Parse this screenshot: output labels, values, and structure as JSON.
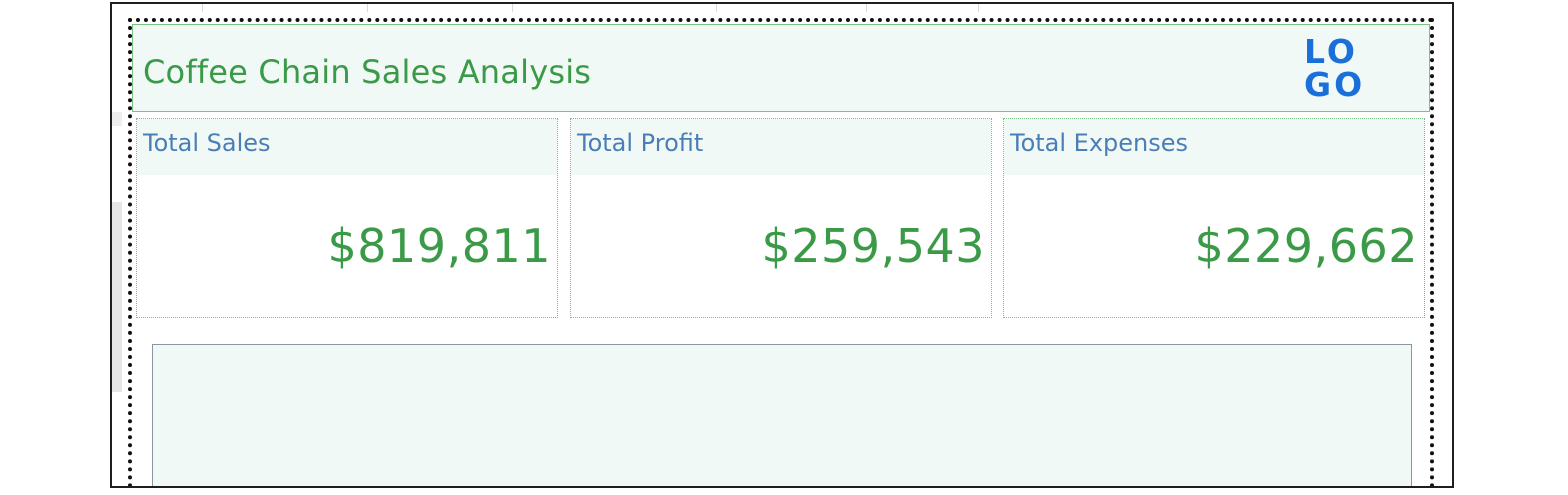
{
  "dashboard": {
    "title": "Coffee Chain Sales Analysis",
    "logo": {
      "line1": "LO",
      "line2": "GO",
      "color": "#1a6fd9"
    },
    "accent_color": "#3a9a47",
    "label_color": "#4a7fb5",
    "background_color": "#f1f9f7"
  },
  "kpis": [
    {
      "label": "Total Sales",
      "value": "$819,811"
    },
    {
      "label": "Total Profit",
      "value": "$259,543"
    },
    {
      "label": "Total Expenses",
      "value": "$229,662"
    }
  ]
}
